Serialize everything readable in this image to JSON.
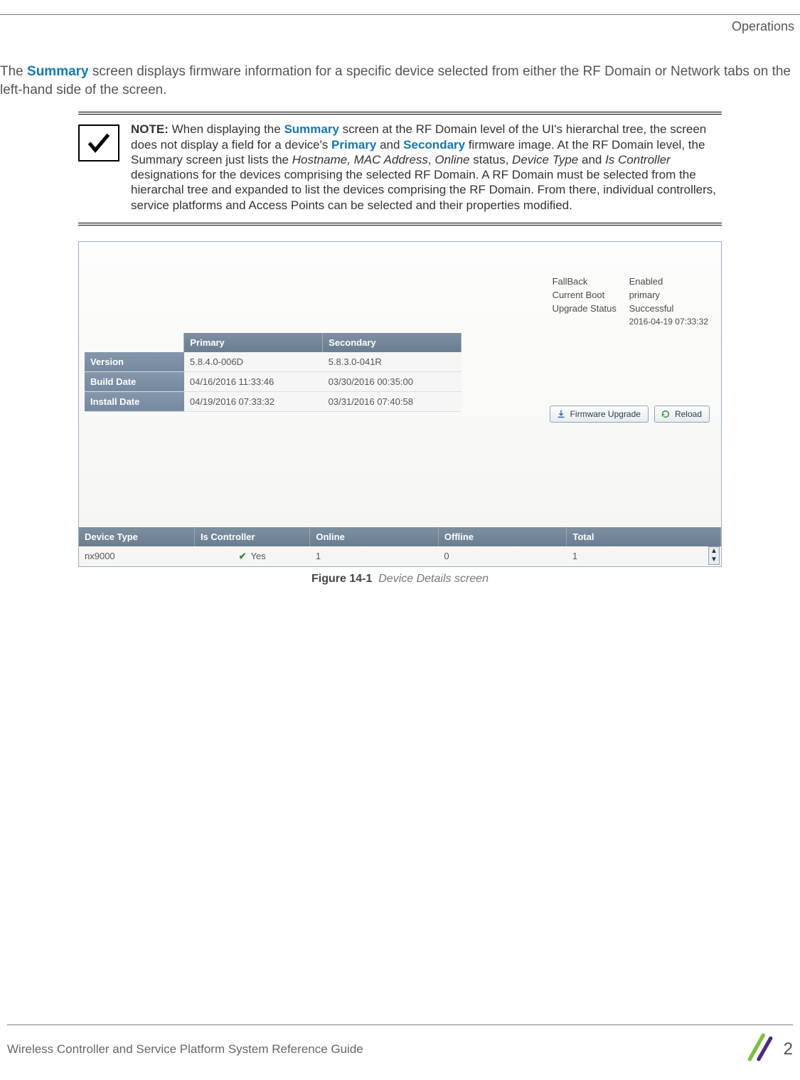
{
  "header": {
    "section": "Operations"
  },
  "intro": {
    "pre": "The ",
    "summary": "Summary",
    "post": " screen displays firmware information for a specific device selected from either the RF Domain or Network tabs on the left-hand side of the screen."
  },
  "note": {
    "label": "NOTE:",
    "t1": " When displaying the ",
    "summary": "Summary",
    "t2": " screen at the RF Domain level of the UI's hierarchal tree, the screen does not display a field for a device's ",
    "primary": "Primary",
    "t3": " and ",
    "secondary": "Secondary",
    "t4": " firmware image. At the RF Domain level, the Summary screen just lists the ",
    "it1": "Hostname, MAC Address",
    "t5": ", ",
    "it2": "Online",
    "t6": " status, ",
    "it3": "Device Type",
    "t7": " and ",
    "it4": "Is Controller",
    "t8": " designations for the devices comprising the selected RF Domain. A RF Domain must be selected from the hierarchal tree and expanded to list the devices comprising the RF Domain. From there, individual controllers, service platforms and Access Points can be selected and their properties modified."
  },
  "status": {
    "fallback_label": "FallBack",
    "fallback_value": "Enabled",
    "boot_label": "Current Boot",
    "boot_value": "primary",
    "upgrade_label": "Upgrade Status",
    "upgrade_value": "Successful",
    "timestamp": "2016-04-19 07:33:32"
  },
  "fw_table": {
    "col_primary": "Primary",
    "col_secondary": "Secondary",
    "rows": [
      {
        "label": "Version",
        "primary": "5.8.4.0-006D",
        "secondary": "5.8.3.0-041R"
      },
      {
        "label": "Build Date",
        "primary": "04/16/2016 11:33:46",
        "secondary": "03/30/2016 00:35:00"
      },
      {
        "label": "Install Date",
        "primary": "04/19/2016 07:33:32",
        "secondary": "03/31/2016 07:40:58"
      }
    ]
  },
  "buttons": {
    "firmware_upgrade": "Firmware Upgrade",
    "reload": "Reload"
  },
  "dev_table": {
    "headers": {
      "device_type": "Device Type",
      "is_controller": "Is Controller",
      "online": "Online",
      "offline": "Offline",
      "total": "Total"
    },
    "row": {
      "device_type": "nx9000",
      "is_controller": "Yes",
      "online": "1",
      "offline": "0",
      "total": "1"
    }
  },
  "figure": {
    "label": "Figure 14-1",
    "caption": "Device Details screen"
  },
  "footer": {
    "guide": "Wireless Controller and Service Platform System Reference Guide",
    "page": "2"
  },
  "chart_data": {
    "type": "table",
    "title": "Firmware summary",
    "status": {
      "FallBack": "Enabled",
      "Current Boot": "primary",
      "Upgrade Status": "Successful",
      "Upgrade Timestamp": "2016-04-19 07:33:32"
    },
    "firmware": {
      "columns": [
        "",
        "Primary",
        "Secondary"
      ],
      "rows": [
        [
          "Version",
          "5.8.4.0-006D",
          "5.8.3.0-041R"
        ],
        [
          "Build Date",
          "04/16/2016 11:33:46",
          "03/30/2016 00:35:00"
        ],
        [
          "Install Date",
          "04/19/2016 07:33:32",
          "03/31/2016 07:40:58"
        ]
      ]
    },
    "device_summary": {
      "columns": [
        "Device Type",
        "Is Controller",
        "Online",
        "Offline",
        "Total"
      ],
      "rows": [
        [
          "nx9000",
          "Yes",
          1,
          0,
          1
        ]
      ]
    }
  }
}
